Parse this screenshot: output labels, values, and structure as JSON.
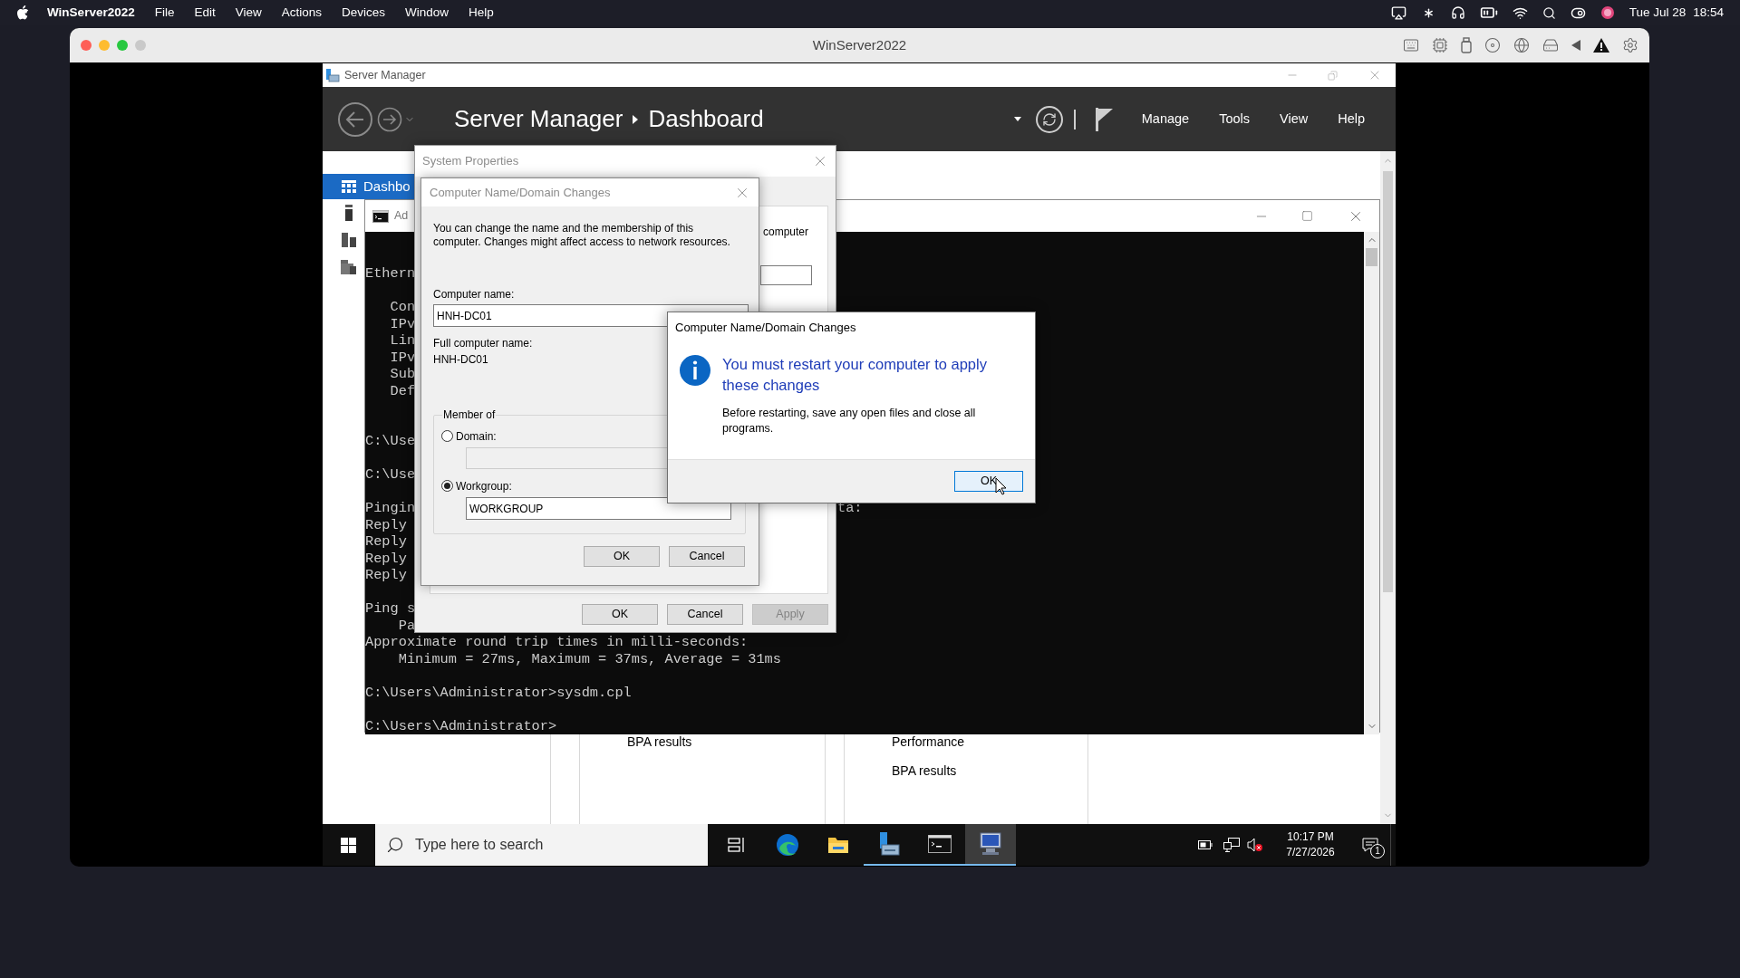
{
  "menu_bar": {
    "app_name": "WinServer2022",
    "items": [
      "File",
      "Edit",
      "View",
      "Actions",
      "Devices",
      "Window",
      "Help"
    ],
    "clock_date": "Tue Jul 28",
    "clock_time": "18:54"
  },
  "vm_window": {
    "title": "WinServer2022"
  },
  "server_manager": {
    "title": "Server Manager",
    "breadcrumb": [
      "Server Manager",
      "Dashboard"
    ],
    "menu": [
      "Manage",
      "Tools",
      "View",
      "Help"
    ],
    "nav": [
      {
        "label": "Dashbo",
        "selected": true
      },
      {
        "selected": false
      },
      {
        "selected": false
      },
      {
        "selected": false
      }
    ],
    "tiles": [
      {
        "items": [
          "BPA results"
        ]
      },
      {
        "items": [
          "Performance",
          "BPA results"
        ]
      }
    ]
  },
  "cmd_window": {
    "title": "Ad",
    "lines": [
      {
        "kind": "blank"
      },
      {
        "kind": "blank"
      },
      {
        "kind": "text",
        "text": "Ethern"
      },
      {
        "kind": "blank"
      },
      {
        "kind": "text",
        "text": "   Con"
      },
      {
        "kind": "text",
        "text": "   IPv"
      },
      {
        "kind": "text",
        "text": "   Lin"
      },
      {
        "kind": "text",
        "text": "   IPv"
      },
      {
        "kind": "text",
        "text": "   Sub"
      },
      {
        "kind": "text",
        "text": "   Def"
      },
      {
        "kind": "blank"
      },
      {
        "kind": "blank"
      },
      {
        "kind": "text",
        "text": "C:\\Use"
      },
      {
        "kind": "blank"
      },
      {
        "kind": "text",
        "text": "C:\\Use"
      },
      {
        "kind": "blank"
      },
      {
        "kind": "text",
        "text": "Pingin",
        "tail": "ta:"
      },
      {
        "kind": "text",
        "text": "Reply"
      },
      {
        "kind": "text",
        "text": "Reply"
      },
      {
        "kind": "text",
        "text": "Reply"
      },
      {
        "kind": "text",
        "text": "Reply"
      },
      {
        "kind": "blank"
      },
      {
        "kind": "text",
        "text": "Ping s"
      },
      {
        "kind": "text",
        "text": "    Pa"
      },
      {
        "kind": "text",
        "text": "Approximate round trip times in milli-seconds:"
      },
      {
        "kind": "text",
        "text": "    Minimum = 27ms, Maximum = 37ms, Average = 31ms"
      },
      {
        "kind": "blank"
      },
      {
        "kind": "text",
        "text": "C:\\Users\\Administrator>sysdm.cpl"
      },
      {
        "kind": "blank"
      },
      {
        "kind": "text",
        "text": "C:\\Users\\Administrator>"
      }
    ]
  },
  "system_properties": {
    "title": "System Properties",
    "panel_text": "computer",
    "buttons": [
      {
        "label": "OK",
        "disabled": false
      },
      {
        "label": "Cancel",
        "disabled": false
      },
      {
        "label": "Apply",
        "disabled": true
      }
    ]
  },
  "name_dialog": {
    "title": "Computer Name/Domain Changes",
    "description": "You can change the name and the membership of this computer. Changes might affect access to network resources.",
    "computer_name_label": "Computer name:",
    "computer_name": "HNH-DC01",
    "full_name_label": "Full computer name:",
    "full_name": "HNH-DC01",
    "group_label": "Member of",
    "options": [
      {
        "label": "Domain:",
        "selected": false
      },
      {
        "label": "Workgroup:",
        "selected": true,
        "value": "WORKGROUP"
      }
    ],
    "buttons": [
      "OK",
      "Cancel"
    ]
  },
  "message_box": {
    "title": "Computer Name/Domain Changes",
    "heading": "You must restart your computer to apply these changes",
    "text": "Before restarting, save any open files and close all programs.",
    "button": {
      "label": "OK",
      "focused": true
    }
  },
  "taskbar": {
    "search_placeholder": "Type here to search",
    "apps": [
      {
        "kind": "task-view",
        "running": false,
        "selected": false
      },
      {
        "kind": "swirl",
        "running": false,
        "selected": false
      },
      {
        "kind": "folder",
        "running": false,
        "selected": false
      },
      {
        "kind": "server-manager",
        "running": true,
        "selected": false
      },
      {
        "kind": "terminal",
        "running": true,
        "selected": false
      },
      {
        "kind": "system",
        "running": true,
        "selected": true
      }
    ],
    "time": "10:17 PM",
    "date": "7/27/2026",
    "notification_count": "1"
  }
}
